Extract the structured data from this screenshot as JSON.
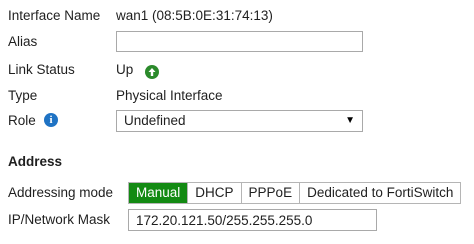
{
  "interface": {
    "label": "Interface Name",
    "value": "wan1 (08:5B:0E:31:74:13)"
  },
  "alias": {
    "label": "Alias",
    "value": ""
  },
  "link_status": {
    "label": "Link Status",
    "value": "Up",
    "icon": "arrow-up-circle-icon",
    "icon_color": "#2b8a2b"
  },
  "type": {
    "label": "Type",
    "value": "Physical Interface"
  },
  "role": {
    "label": "Role",
    "info_icon": "info-icon",
    "selected": "Undefined"
  },
  "address": {
    "section_title": "Address",
    "addressing_mode_label": "Addressing mode",
    "modes": [
      {
        "label": "Manual",
        "active": true
      },
      {
        "label": "DHCP",
        "active": false
      },
      {
        "label": "PPPoE",
        "active": false
      },
      {
        "label": "Dedicated to FortiSwitch",
        "active": false
      }
    ],
    "active_color": "#138a13",
    "ip_mask_label": "IP/Network Mask",
    "ip_mask_value": "172.20.121.50/255.255.255.0"
  }
}
